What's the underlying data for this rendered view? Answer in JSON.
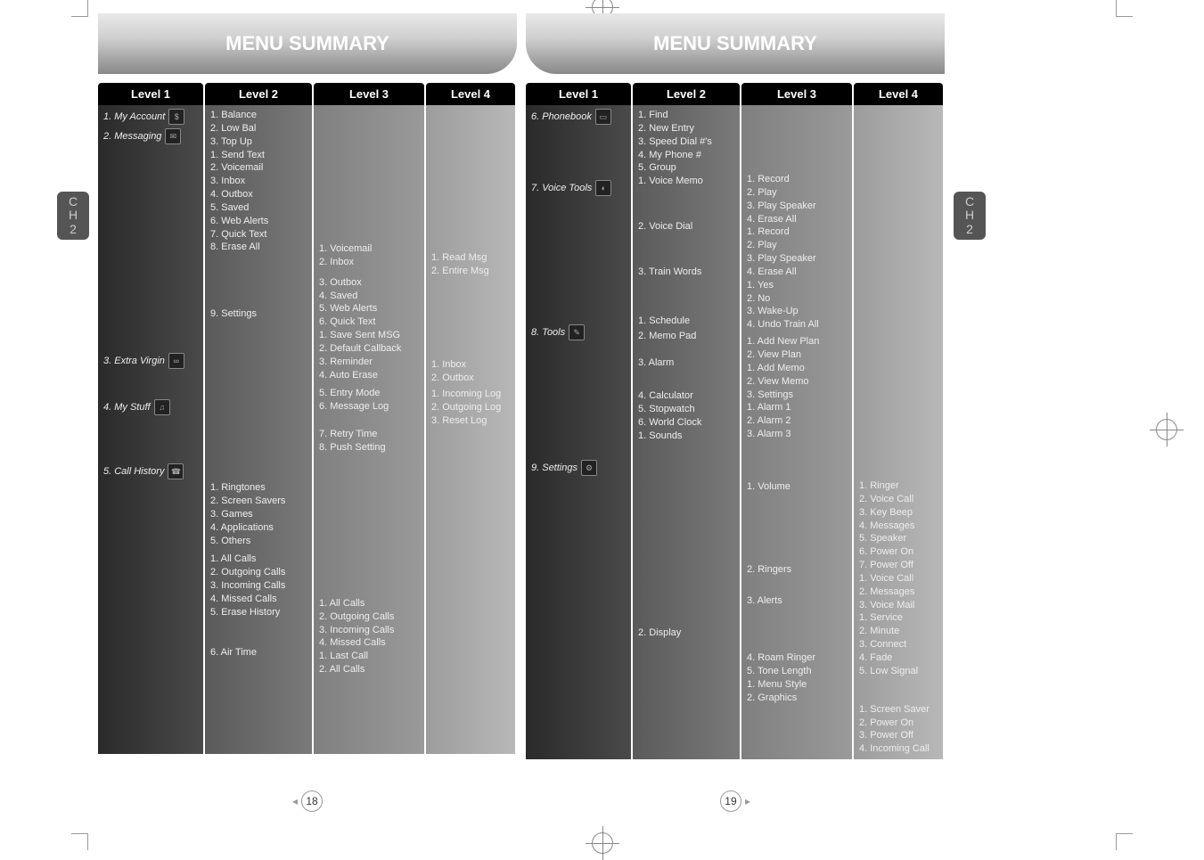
{
  "chapter_tab": {
    "line1": "C",
    "line2": "H",
    "num": "2"
  },
  "page_left": {
    "title": "MENU SUMMARY",
    "headers": [
      "Level 1",
      "Level 2",
      "Level 3",
      "Level 4"
    ],
    "page_number": "18",
    "level1": [
      {
        "title": "1. My Account",
        "icon": "$"
      },
      {
        "title": "2. Messaging",
        "icon": "✉",
        "gap_after": 230
      },
      {
        "title": "3. Extra Virgin",
        "icon": "∞",
        "gap_after": 30
      },
      {
        "title": "4. My Stuff",
        "icon": "♫",
        "gap_after": 50
      },
      {
        "title": "5. Call History",
        "icon": "☎"
      }
    ],
    "level2": [
      {
        "items": [
          "1. Balance",
          "2. Low Bal",
          "3. Top Up"
        ]
      },
      {
        "items": [
          "1. Send Text",
          "2. Voicemail",
          "3. Inbox",
          "4. Outbox",
          "5. Saved",
          "6. Web Alerts",
          "7. Quick Text",
          "8. Erase All"
        ],
        "gap_after": 60
      },
      {
        "items": [
          "9. Settings"
        ],
        "gap_after": 180
      },
      {
        "items": [
          "1. Ringtones",
          "2. Screen Savers",
          "3. Games",
          "4. Applications",
          "5. Others"
        ],
        "gap_after": 6
      },
      {
        "items": [
          "1. All Calls",
          "2. Outgoing Calls",
          "3. Incoming Calls",
          "4. Missed Calls",
          "5. Erase History"
        ],
        "gap_after": 30
      },
      {
        "items": [
          "6. Air Time"
        ]
      }
    ],
    "level3": [
      {
        "gap_before": 150,
        "items": [
          "1. Voicemail",
          "2. Inbox"
        ],
        "gap_after": 8
      },
      {
        "items": [
          "3. Outbox",
          "4. Saved",
          "5. Web Alerts",
          "6. Quick Text",
          "1. Save Sent MSG",
          "2. Default Callback",
          "3. Reminder",
          "4. Auto Erase"
        ],
        "gap_after": 6
      },
      {
        "items": [
          "5. Entry Mode",
          "6. Message Log"
        ],
        "gap_after": 16
      },
      {
        "items": [
          "7. Retry Time",
          "8. Push Setting"
        ],
        "gap_after": 160
      },
      {
        "items": [
          "1. All Calls",
          "2. Outgoing Calls",
          "3. Incoming Calls",
          "4. Missed Calls",
          "1. Last Call",
          "2. All Calls"
        ]
      }
    ],
    "level4": [
      {
        "gap_before": 160,
        "items": [
          "1. Read Msg",
          "2. Entire Msg"
        ],
        "gap_after": 90
      },
      {
        "items": [
          "1. Inbox",
          "2. Outbox"
        ],
        "gap_after": 4
      },
      {
        "items": [
          "1. Incoming Log",
          "2. Outgoing Log",
          "3. Reset Log"
        ]
      }
    ]
  },
  "page_right": {
    "title": "MENU SUMMARY",
    "headers": [
      "Level 1",
      "Level 2",
      "Level 3",
      "Level 4"
    ],
    "page_number": "19",
    "level1": [
      {
        "title": "6. Phonebook",
        "icon": "▭",
        "gap_after": 58
      },
      {
        "title": "7. Voice Tools",
        "icon": "◐",
        "gap_after": 140
      },
      {
        "title": "8. Tools",
        "icon": "✎",
        "gap_after": 130
      },
      {
        "title": "9. Settings",
        "icon": "⚙"
      }
    ],
    "level2": [
      {
        "items": [
          "1. Find",
          "2. New Entry",
          "3. Speed Dial #'s",
          "4. My Phone #",
          "5. Group"
        ]
      },
      {
        "items": [
          "1. Voice Memo"
        ],
        "gap_after": 36
      },
      {
        "items": [
          "2. Voice Dial"
        ],
        "gap_after": 36
      },
      {
        "items": [
          "3. Train Words"
        ],
        "gap_after": 40
      },
      {
        "items": [
          "1. Schedule"
        ],
        "gap_after": 2
      },
      {
        "items": [
          "2. Memo Pad"
        ],
        "gap_after": 16
      },
      {
        "items": [
          "3. Alarm"
        ],
        "gap_after": 22
      },
      {
        "items": [
          "4. Calculator",
          "5. Stopwatch",
          "6. World Clock"
        ]
      },
      {
        "items": [
          "1. Sounds"
        ],
        "gap_after": 206
      },
      {
        "items": [
          "2. Display"
        ]
      }
    ],
    "level3": [
      {
        "gap_before": 72,
        "items": [
          "1. Record",
          "2. Play",
          "3. Play Speaker",
          "4. Erase All",
          "1. Record",
          "2. Play",
          "3. Play Speaker",
          "4. Erase All",
          "1. Yes",
          "2. No",
          "3. Wake-Up",
          "4. Undo Train All"
        ],
        "gap_after": 4
      },
      {
        "items": [
          "1. Add New Plan",
          "2. View Plan",
          "1. Add Memo",
          "2. View Memo",
          "3. Settings",
          "1. Alarm 1",
          "2. Alarm 2",
          "3. Alarm 3"
        ],
        "gap_after": 44
      },
      {
        "items": [
          "1. Volume"
        ],
        "gap_after": 78
      },
      {
        "items": [
          "2. Ringers"
        ],
        "gap_after": 20
      },
      {
        "items": [
          "3. Alerts"
        ],
        "gap_after": 50
      },
      {
        "items": [
          "4. Roam Ringer",
          "5. Tone Length",
          "1. Menu Style",
          "2. Graphics"
        ]
      }
    ],
    "level4": [
      {
        "gap_before": 416,
        "items": [
          "1. Ringer",
          "2. Voice Call",
          "3. Key Beep",
          "4. Messages",
          "5. Speaker",
          "6. Power On",
          "7. Power Off",
          "1. Voice Call",
          "2. Messages",
          "3. Voice Mail",
          "1. Service",
          "2. Minute",
          "3. Connect",
          "4. Fade",
          "5. Low Signal"
        ],
        "gap_after": 28
      },
      {
        "items": [
          "1. Screen Saver",
          "2. Power On",
          "3. Power Off",
          "4. Incoming Call"
        ]
      }
    ]
  }
}
